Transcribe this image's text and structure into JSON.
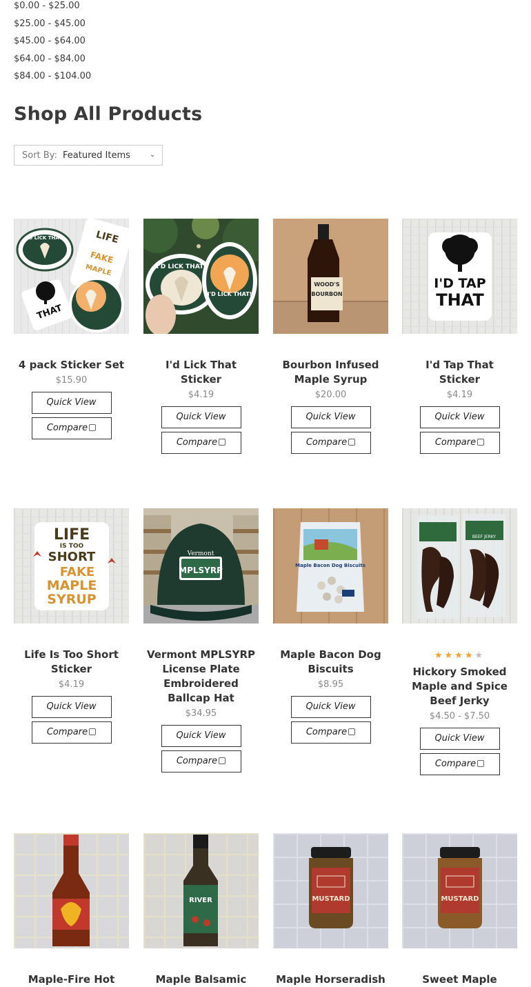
{
  "price_filters": [
    "$0.00 - $25.00",
    "$25.00 - $45.00",
    "$45.00 - $64.00",
    "$64.00 - $84.00",
    "$84.00 - $104.00"
  ],
  "page_title": "Shop All Products",
  "sort": {
    "label": "Sort By:",
    "value": "Featured Items"
  },
  "buttons": {
    "quick_view": "Quick View",
    "compare": "Compare"
  },
  "products": [
    {
      "name": "4 pack Sticker Set",
      "price": "$15.90"
    },
    {
      "name": "I'd Lick That Sticker",
      "price": "$4.19"
    },
    {
      "name": "Bourbon Infused Maple Syrup",
      "price": "$20.00"
    },
    {
      "name": "I'd Tap That Sticker",
      "price": "$4.19"
    },
    {
      "name": "Life Is Too Short Sticker",
      "price": "$4.19"
    },
    {
      "name": "Vermont MPLSYRP License Plate Embroidered Ballcap Hat",
      "price": "$34.95"
    },
    {
      "name": "Maple Bacon Dog Biscuits",
      "price": "$8.95"
    },
    {
      "name": "Hickory Smoked Maple and Spice Beef Jerky",
      "price": "$4.50 - $7.50",
      "rating": 4,
      "rating_max": 5
    },
    {
      "name": "Maple-Fire Hot"
    },
    {
      "name": "Maple Balsamic"
    },
    {
      "name": "Maple Horseradish"
    },
    {
      "name": "Sweet Maple"
    }
  ],
  "image_text": {
    "lick": "I'D LICK THAT!",
    "tap1": "I'D TAP",
    "tap2": "THAT",
    "life1": "LIFE",
    "life2": "IS TOO",
    "life3": "SHORT",
    "life4": "FAKE",
    "life5": "MAPLE",
    "life6": "SYRUP",
    "woods1": "WOOD'S",
    "woods2": "BOURBON",
    "hat1": "Vermont",
    "hat2": "MPLSYRP",
    "biscuits": "Maple Bacon Dog Biscuits",
    "jerky": "BEEF JERKY",
    "mustard": "MUSTARD"
  }
}
